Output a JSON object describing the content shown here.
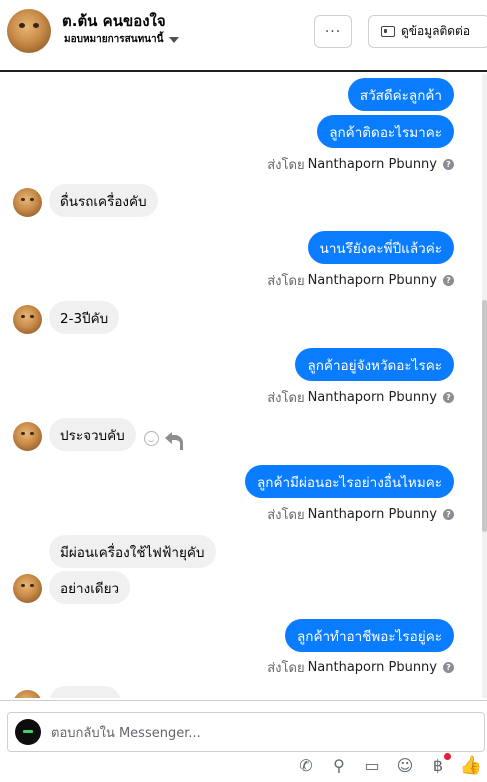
{
  "header": {
    "name": "ต.ต้น คนของใจ",
    "assign": "มอบหมายการสนทนานี้",
    "more_label": "···",
    "contact_label": "ดูข้อมูลติดต่อ"
  },
  "messages": {
    "m1": "สวัสดีค่ะลูกค้า",
    "m2": "ลูกค้าติดอะไรมาคะ",
    "m3": "ดื่นรถเครื่องคับ",
    "m4": "นานรึยังคะพี่ปีแล้วค่ะ",
    "m5": "2-3ปีคับ",
    "m6": "ลูกค้าอยู่จังหวัดอะไรคะ",
    "m7": "ประจวบคับ",
    "m8": "ลูกค้ามีผ่อนอะไรอย่างอื่นไหมคะ",
    "m9": "มีผ่อนเครื่องใช้ไฟฟ้ายุคับ",
    "m10": "อย่างเดียว",
    "m11": "ลูกค้าทำอาชีพอะไรอยู่คะ"
  },
  "sent_by": {
    "prefix": "ส่งโดย",
    "name": "Nanthaporn Pbunny",
    "help": "?"
  },
  "composer": {
    "placeholder": "ตอบกลับใน Messenger...",
    "icons": [
      "phone-add-icon",
      "attach-icon",
      "saved-reply-icon",
      "emoji-icon",
      "baht-payment-icon",
      "thumbs-up-icon"
    ]
  },
  "colors": {
    "outgoing_bubble": "#0a7cff",
    "incoming_bubble": "#f0f0f0",
    "notification_dot": "#e41e3f"
  }
}
